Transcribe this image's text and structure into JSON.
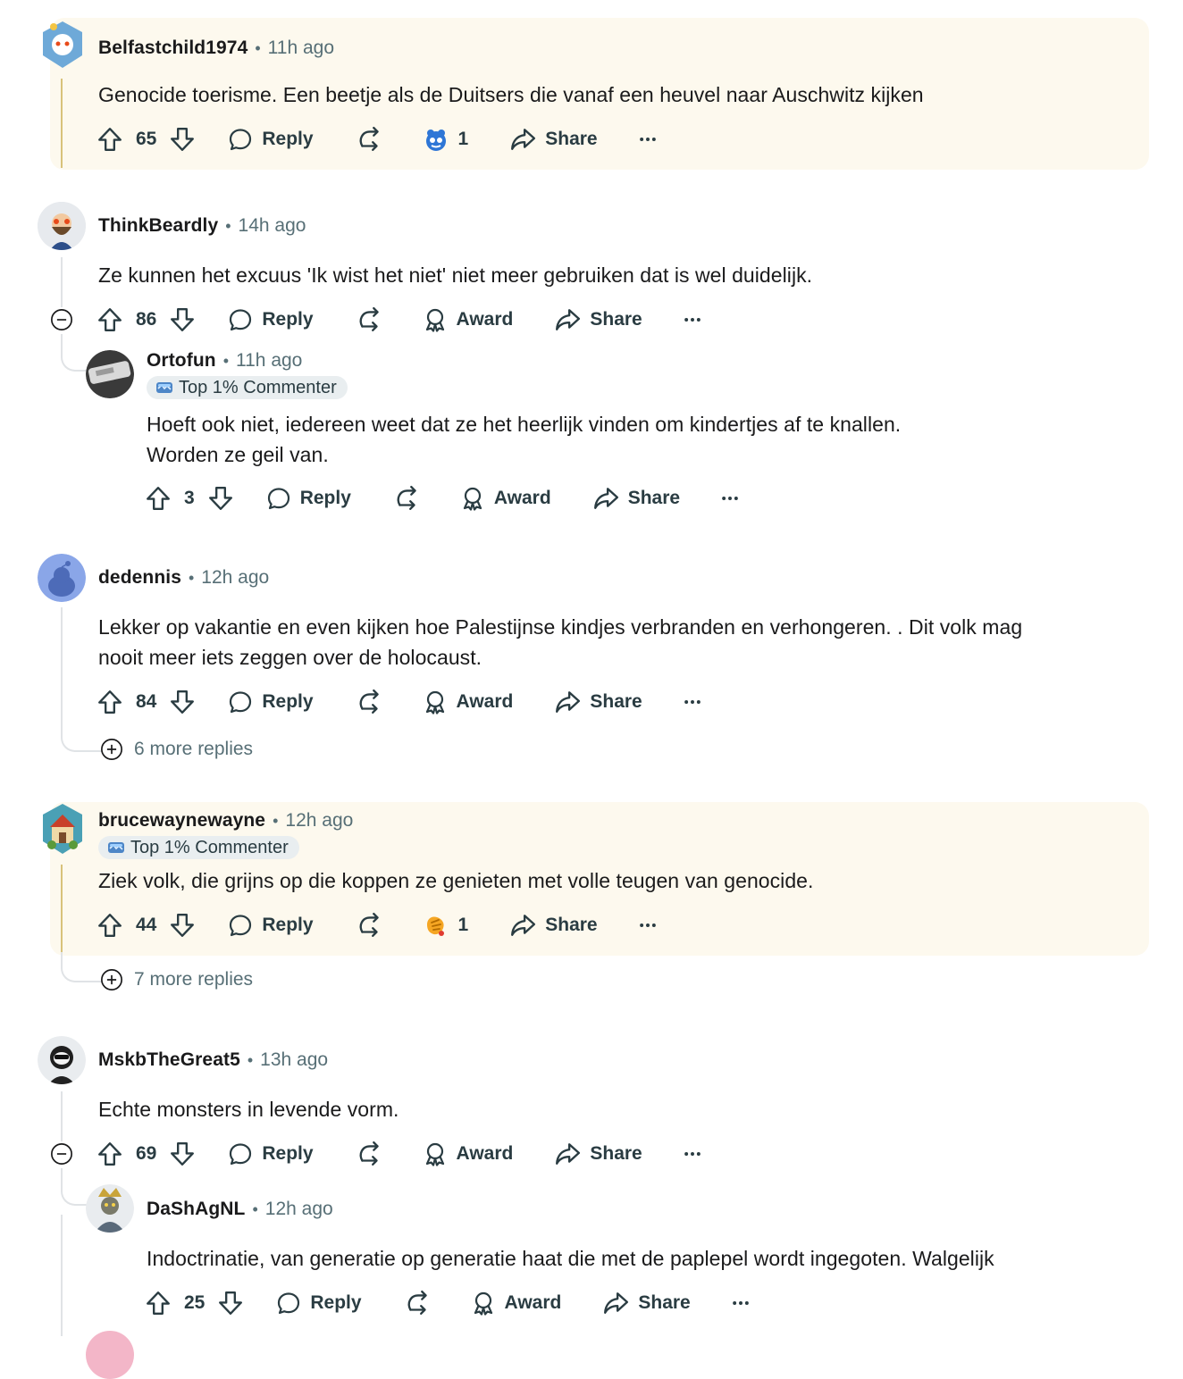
{
  "comments": [
    {
      "user": "Belfastchild1974",
      "time": "11h ago",
      "body": "Genocide toerisme. Een beetje als de Duitsers die vanaf een heuvel naar Auschwitz kijken",
      "score": "65",
      "reply_label": "Reply",
      "award_count": "1",
      "share_label": "Share"
    },
    {
      "user": "ThinkBeardly",
      "time": "14h ago",
      "body": "Ze kunnen het excuus 'Ik wist het niet' niet meer gebruiken dat is wel duidelijk.",
      "score": "86",
      "reply_label": "Reply",
      "award_label": "Award",
      "share_label": "Share"
    },
    {
      "user": "Ortofun",
      "time": "11h ago",
      "flair": "Top 1% Commenter",
      "body_line1": "Hoeft ook niet, iedereen weet dat ze het heerlijk vinden om kindertjes af te knallen.",
      "body_line2": "Worden ze geil van.",
      "score": "3",
      "reply_label": "Reply",
      "award_label": "Award",
      "share_label": "Share"
    },
    {
      "user": "dedennis",
      "time": "12h ago",
      "body_line1": "Lekker op vakantie en even kijken hoe Palestijnse kindjes verbranden en verhongeren. . Dit volk mag",
      "body_line2": "nooit meer iets zeggen over de holocaust.",
      "score": "84",
      "reply_label": "Reply",
      "award_label": "Award",
      "share_label": "Share",
      "more_replies": "6 more replies"
    },
    {
      "user": "brucewaynewayne",
      "time": "12h ago",
      "flair": "Top 1% Commenter",
      "body": "Ziek volk, die grijns op die koppen ze genieten met volle teugen van genocide.",
      "score": "44",
      "reply_label": "Reply",
      "award_count": "1",
      "share_label": "Share",
      "more_replies": "7 more replies"
    },
    {
      "user": "MskbTheGreat5",
      "time": "13h ago",
      "body": "Echte monsters in levende vorm.",
      "score": "69",
      "reply_label": "Reply",
      "award_label": "Award",
      "share_label": "Share"
    },
    {
      "user": "DaShAgNL",
      "time": "12h ago",
      "body": "Indoctrinatie, van generatie op generatie haat die met de paplepel wordt ingegoten. Walgelijk",
      "score": "25",
      "reply_label": "Reply",
      "award_label": "Award",
      "share_label": "Share"
    }
  ],
  "colors": {
    "highlight_bg": "#fdf9ee",
    "meta_gray": "#576f76",
    "thread_line": "#e0e3e6"
  }
}
